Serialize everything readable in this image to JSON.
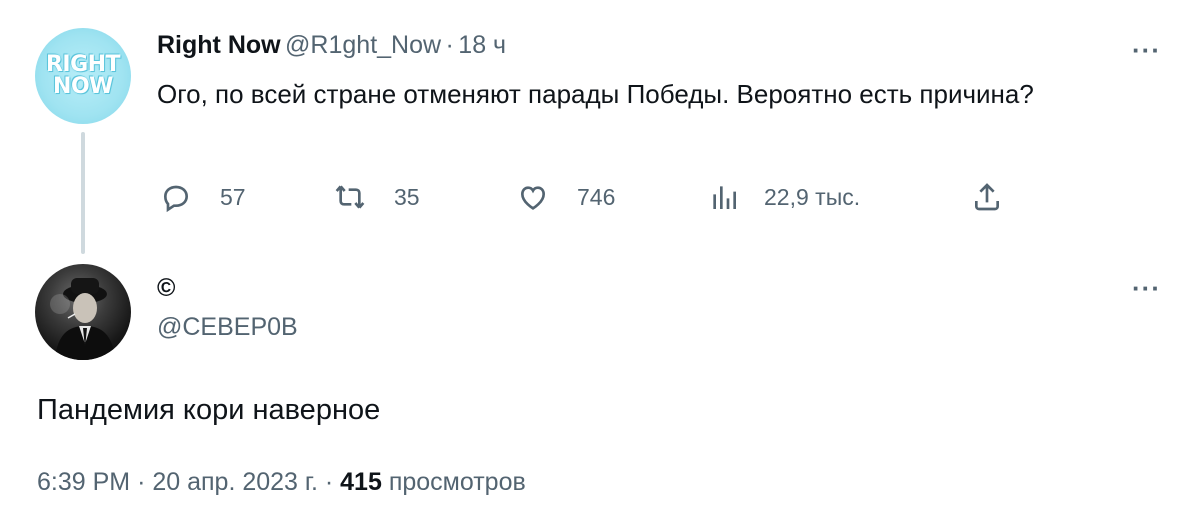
{
  "tweet1": {
    "avatar_text_top": "RIGHT",
    "avatar_text_bottom": "NOW",
    "display_name": "Right Now",
    "handle": "@R1ght_Now",
    "separator": "·",
    "time": "18 ч",
    "text": "Ого, по всей стране отменяют парады Победы. Вероятно есть причина?",
    "more": "···",
    "replies": "57",
    "retweets": "35",
    "likes": "746",
    "views": "22,9 тыс."
  },
  "tweet2": {
    "display_name": "©",
    "handle": "@СЕВЕР0В",
    "more": "···",
    "text": "Пандемия кори наверное",
    "time": "6:39 PM",
    "date": "20 апр. 2023 г.",
    "separator1": "·",
    "separator2": "·",
    "views_count": "415",
    "views_label": "просмотров"
  },
  "colors": {
    "text_primary": "#0f1419",
    "text_secondary": "#536471",
    "thread_line": "#cfd9de",
    "avatar_bg": "#9fe3f1"
  },
  "icons": [
    "reply-icon",
    "retweet-icon",
    "like-icon",
    "views-icon",
    "share-icon",
    "more-icon"
  ]
}
